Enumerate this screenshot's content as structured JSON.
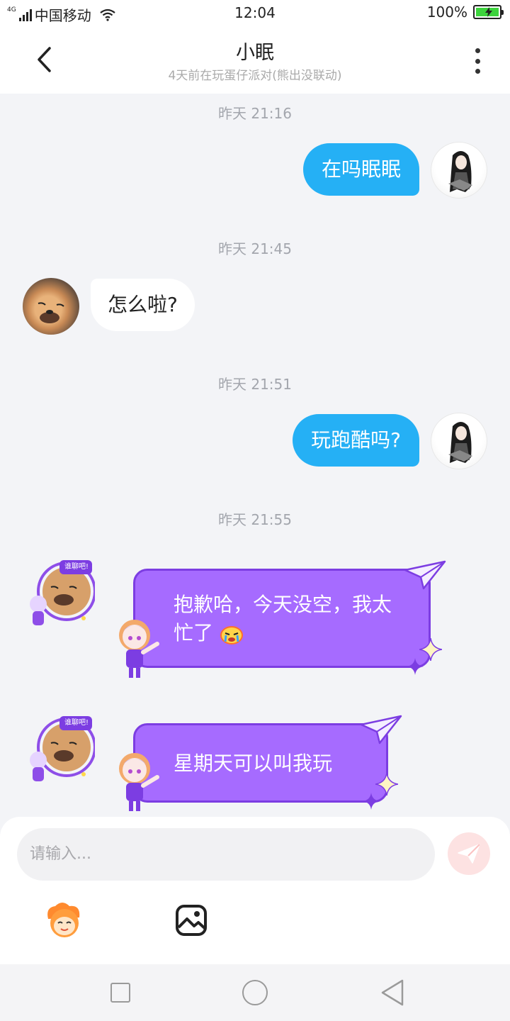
{
  "status_bar": {
    "network_type": "4G",
    "carrier": "中国移动",
    "time": "12:04",
    "battery_percent": "100%",
    "battery_level": 1.0
  },
  "header": {
    "title": "小眠",
    "subtitle": "4天前在玩蛋仔派对(熊出没联动)"
  },
  "messages": [
    {
      "timestamp": "昨天 21:16",
      "direction": "out",
      "text": "在吗眠眠"
    },
    {
      "timestamp": "昨天 21:45",
      "direction": "in",
      "text": "怎么啦?"
    },
    {
      "timestamp": "昨天 21:51",
      "direction": "out",
      "text": "玩跑酷吗?"
    },
    {
      "timestamp": "昨天 21:55",
      "direction": "in",
      "text": "抱歉哈，今天没空，我太忙了",
      "emoji": "crying-face"
    },
    {
      "direction": "in",
      "text": "星期天可以叫我玩"
    }
  ],
  "avatar_badge_text": "谁聊吧!",
  "composer": {
    "placeholder": "请输入..."
  },
  "colors": {
    "outgoing_bubble": "#25b0f5",
    "themed_bubble": "#a66bff",
    "themed_bubble_border": "#7c3de2",
    "send_button_disabled": "#fde2e2"
  }
}
